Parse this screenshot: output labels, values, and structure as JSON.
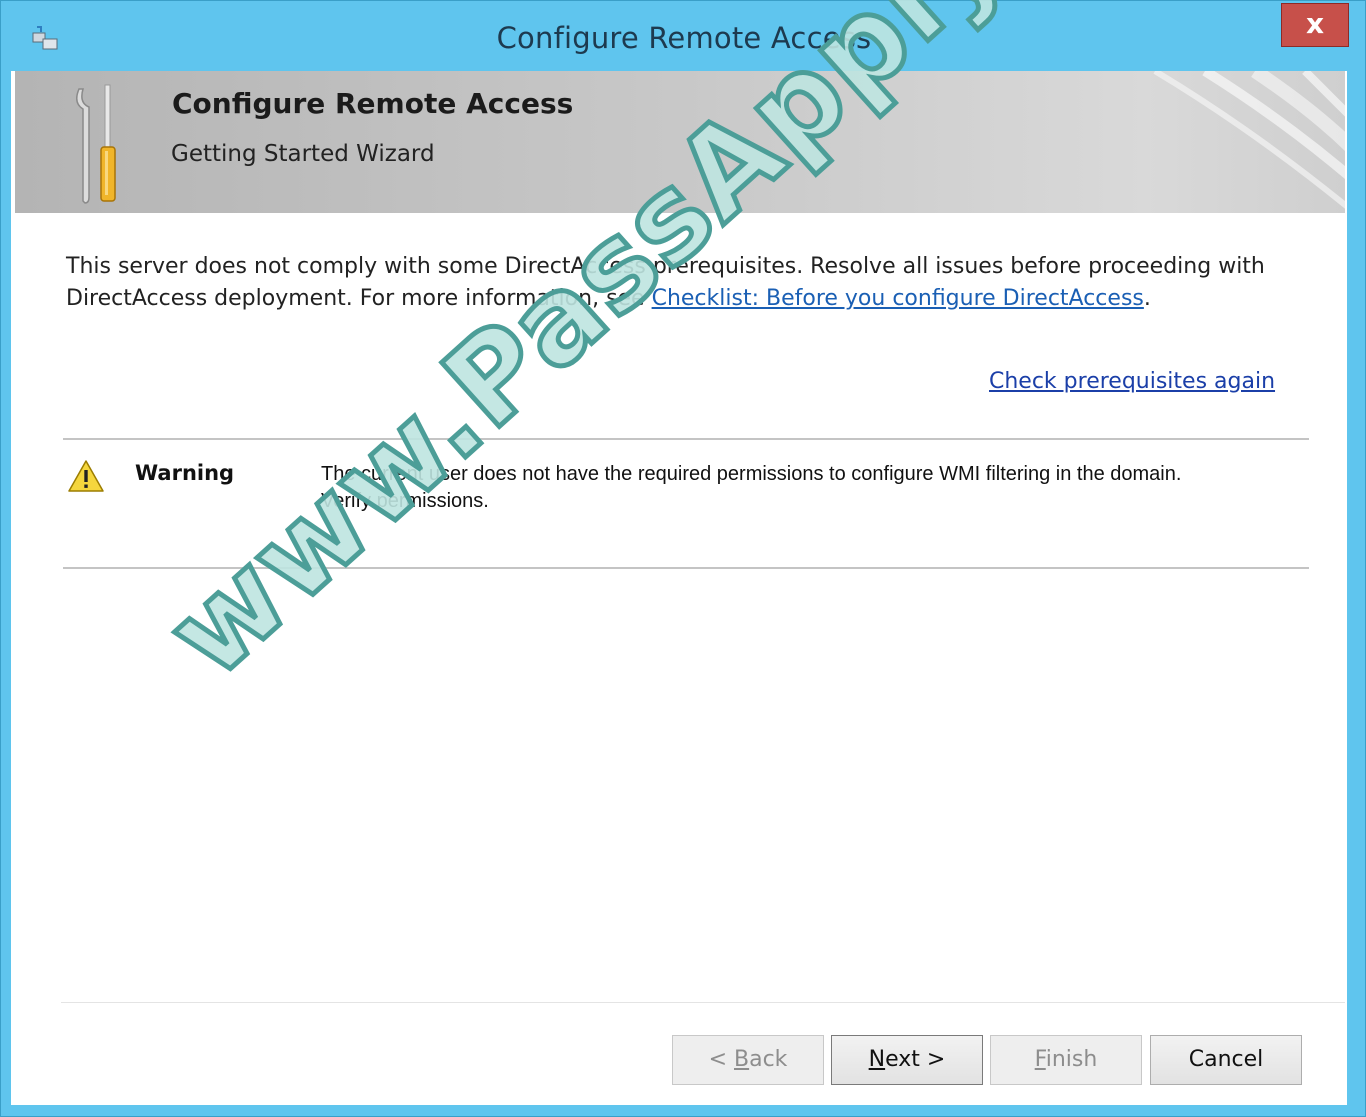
{
  "window": {
    "title": "Configure Remote Access",
    "close_label": "x"
  },
  "header": {
    "title": "Configure Remote Access",
    "subtitle": "Getting Started Wizard"
  },
  "intro": {
    "text_before_link": "This server does not comply with some DirectAccess prerequisites. Resolve all issues before proceeding with DirectAccess deployment. For more information, see ",
    "link_text": "Checklist: Before you configure DirectAccess",
    "text_after_link": "."
  },
  "recheck_link": "Check prerequisites again",
  "issues": [
    {
      "level": "Warning",
      "icon": "warning-icon",
      "message": "The current user does not have the required permissions to configure WMI filtering in the domain. Verify permissions."
    }
  ],
  "buttons": {
    "back": {
      "prefix": "< ",
      "mnemonic": "B",
      "rest": "ack",
      "enabled": false
    },
    "next": {
      "mnemonic": "N",
      "rest": "ext >",
      "enabled": true
    },
    "finish": {
      "mnemonic": "F",
      "rest": "inish",
      "enabled": false
    },
    "cancel": {
      "label": "Cancel",
      "enabled": true
    }
  },
  "watermark": "www.PassApply.com",
  "colors": {
    "titlebar": "#5fc5ee",
    "close": "#c7504a",
    "link": "#1a5fb4"
  }
}
